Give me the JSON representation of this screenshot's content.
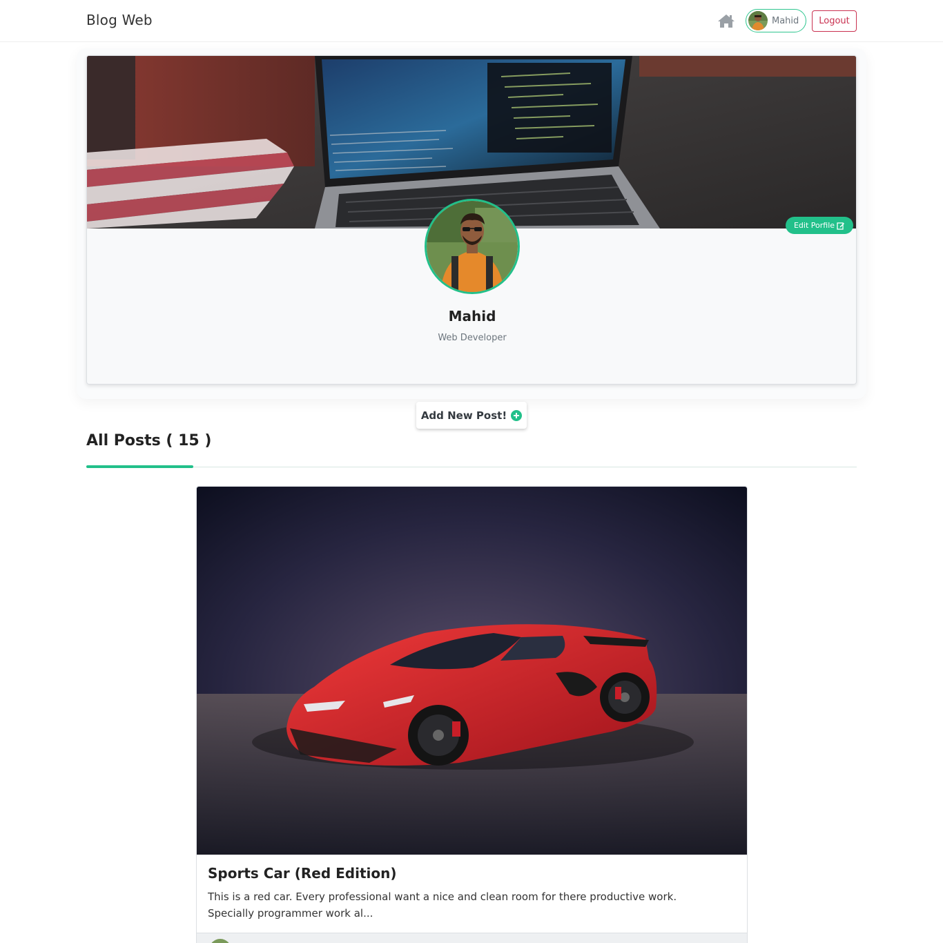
{
  "navbar": {
    "brand": "Blog Web",
    "home_icon": "home-icon",
    "user_label": "Mahid",
    "logout_label": "Logout",
    "accent": "#22c08a",
    "danger": "#c9304f"
  },
  "profile": {
    "name": "Mahid",
    "role": "Web Developer",
    "edit_label": "Edit Porfile",
    "edit_icon": "edit-icon"
  },
  "add_post": {
    "label": "Add New Post!",
    "icon": "plus-circle-icon"
  },
  "posts": {
    "header": "All Posts ( 15 )",
    "items": [
      {
        "title": "Sports Car (Red Edition)",
        "excerpt_line1": "This is a red car. Every professional want a nice and clean room for there productive work.",
        "excerpt_line2": "Specially programmer work al..."
      }
    ]
  }
}
